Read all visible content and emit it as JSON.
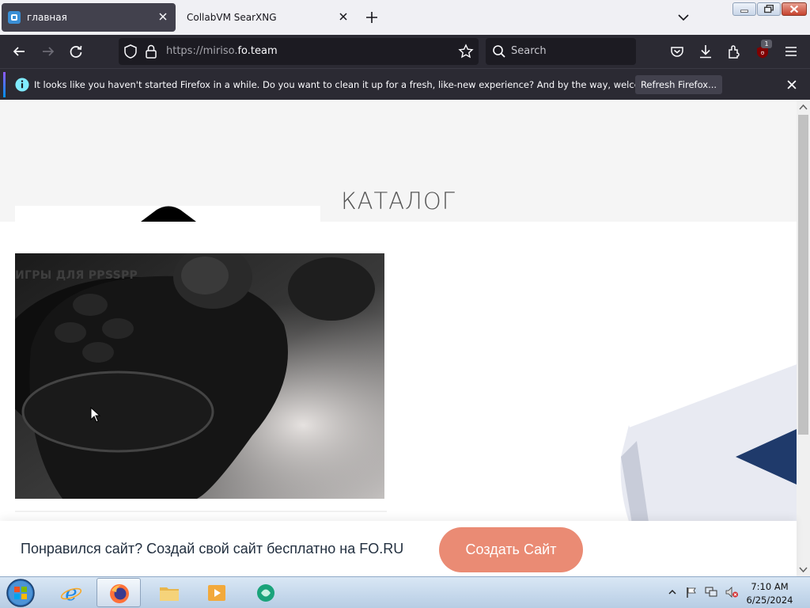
{
  "tabs": [
    {
      "label": "главная",
      "active": true,
      "favicon": "site-icon"
    },
    {
      "label": "CollabVM SearXNG",
      "active": false
    }
  ],
  "navbar": {
    "url_prefix": "https://miriso.",
    "url_domain": "fo.team",
    "search_placeholder": "Search",
    "extension_badge": "1"
  },
  "notification": {
    "message": "It looks like you haven't started Firefox in a while. Do you want to clean it up for a fresh, like-new experience? And by the way, welcome back!",
    "button_label": "Refresh Firefox..."
  },
  "page": {
    "catalog_heading": "КАТАЛОГ",
    "card_label": "ИГРЫ ДЛЯ PPSSPP",
    "card_image": "gamepad-photo"
  },
  "promo": {
    "text": "Понравился сайт? Создай свой сайт бесплатно на FO.RU",
    "button_label": "Создать Сайт",
    "button_color": "#ea8b74"
  },
  "taskbar": {
    "apps": [
      "start-button",
      "internet-explorer-icon",
      "firefox-icon",
      "explorer-icon",
      "media-player-icon",
      "app-icon"
    ],
    "time": "7:10 AM",
    "date": "6/25/2024"
  },
  "colors": {
    "browser_dark": "#2b2a33",
    "urlbar": "#1c1b22",
    "tab_active": "#42414d"
  }
}
